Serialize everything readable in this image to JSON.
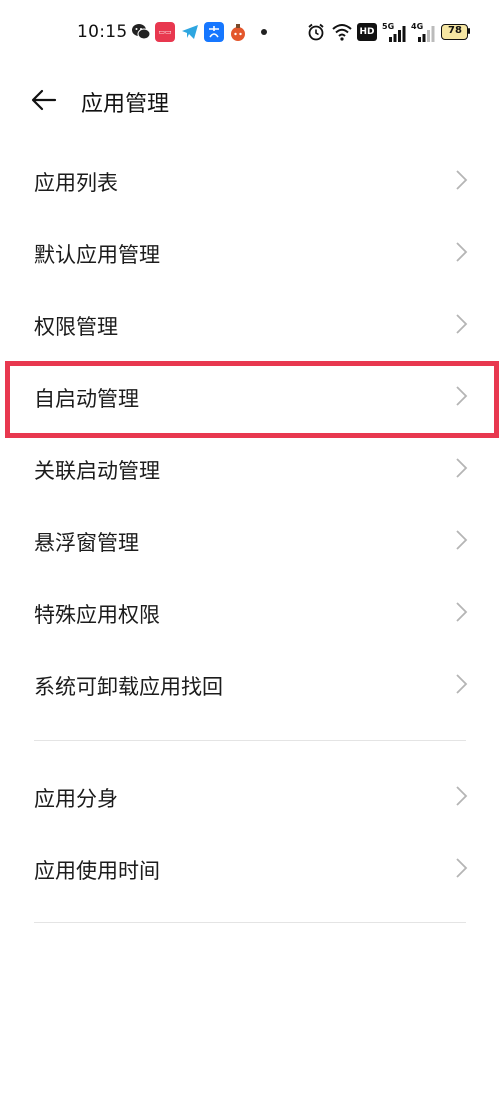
{
  "status_bar": {
    "time": "10:15",
    "battery": "78",
    "notification_icons": [
      "wechat-icon",
      "shopping-app-icon",
      "telegram-icon",
      "alipay-icon",
      "game-app-icon"
    ],
    "system_icons": [
      "alarm-icon",
      "wifi-icon",
      "hd-icon",
      "signal-5g-icon",
      "signal-4g-icon",
      "battery-icon"
    ],
    "labels": {
      "hd": "HD",
      "g5": "5G",
      "g4": "4G"
    }
  },
  "header": {
    "title": "应用管理"
  },
  "list_group_1": [
    {
      "id": "app-list",
      "label": "应用列表"
    },
    {
      "id": "default-apps",
      "label": "默认应用管理"
    },
    {
      "id": "permissions",
      "label": "权限管理"
    },
    {
      "id": "auto-start",
      "label": "自启动管理"
    },
    {
      "id": "associated-start",
      "label": "关联启动管理"
    },
    {
      "id": "floating-window",
      "label": "悬浮窗管理"
    },
    {
      "id": "special-permissions",
      "label": "特殊应用权限"
    },
    {
      "id": "uninstallable-recovery",
      "label": "系统可卸载应用找回"
    }
  ],
  "list_group_2": [
    {
      "id": "app-clone",
      "label": "应用分身"
    },
    {
      "id": "usage-time",
      "label": "应用使用时间"
    }
  ],
  "colors": {
    "highlight": "#e8384f",
    "chevron": "#b5b5b5",
    "divider": "#e4e4e4"
  }
}
